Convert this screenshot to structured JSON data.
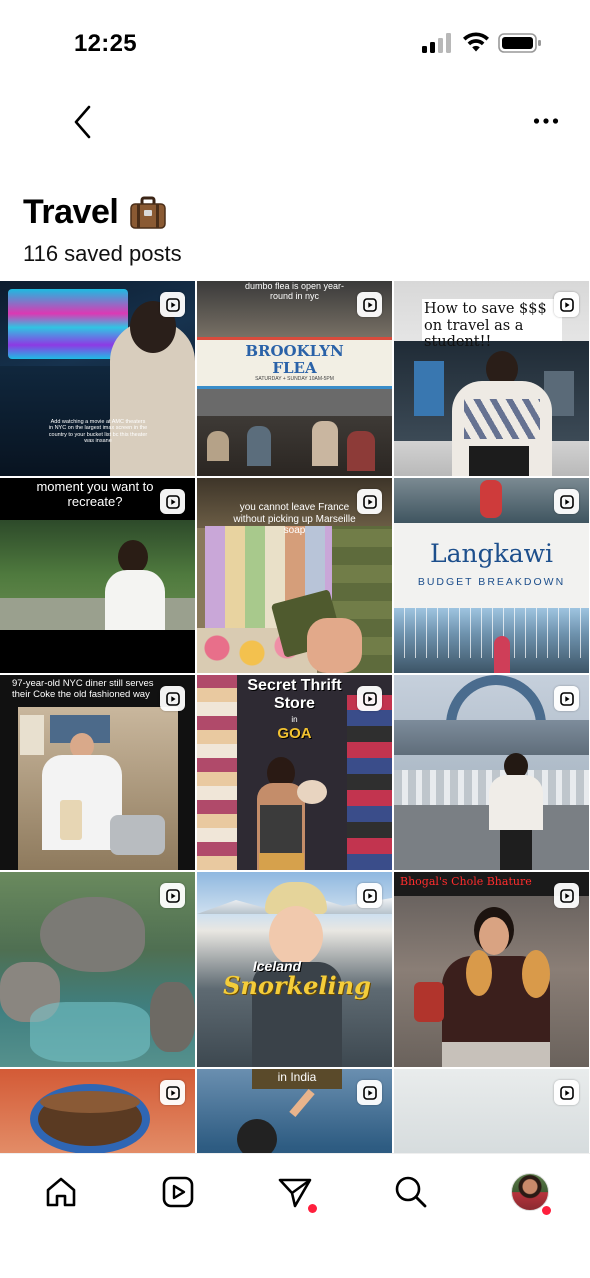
{
  "status_bar": {
    "time": "12:25"
  },
  "header": {
    "title": "Travel",
    "title_emoji_icon": "suitcase-icon",
    "subtitle": "116 saved posts"
  },
  "posts": [
    {
      "caption": "Add watching a movie at AMC theaters in NYC on the largest imax screen in the country to your bucket list bc this theater was insane"
    },
    {
      "caption": "dumbo flea is open year-round in nyc",
      "sign_title": "BROOKLYN FLEA",
      "sign_sub": "SATURDAY + SUNDAY 10AM-5PM"
    },
    {
      "caption": "How to save $$$ on travel as a student!!"
    },
    {
      "caption": "moment you want to recreate?"
    },
    {
      "caption": "you cannot leave France without picking up Marseille soap"
    },
    {
      "caption": "Langkawi",
      "sub_caption": "BUDGET BREAKDOWN"
    },
    {
      "caption": "97-year-old NYC diner still serves their Coke the old fashioned way"
    },
    {
      "caption": "Secret Thrift Store",
      "sub_caption": "in",
      "place": "GOA"
    },
    {
      "caption": ""
    },
    {
      "caption": ""
    },
    {
      "caption": "Iceland",
      "sub_caption": "Snorkeling"
    },
    {
      "caption": "Bhogal's Chole Bhature"
    },
    {
      "caption": ""
    },
    {
      "caption": "in India"
    },
    {
      "caption": ""
    }
  ],
  "bottom_nav": [
    {
      "icon": "home-icon"
    },
    {
      "icon": "reels-icon"
    },
    {
      "icon": "direct-message-icon",
      "badge": true
    },
    {
      "icon": "search-icon"
    },
    {
      "icon": "profile-avatar",
      "badge": true
    }
  ],
  "colors": {
    "accent_red": "#ff1f3d",
    "langkawi_blue": "#1d4f8c"
  }
}
